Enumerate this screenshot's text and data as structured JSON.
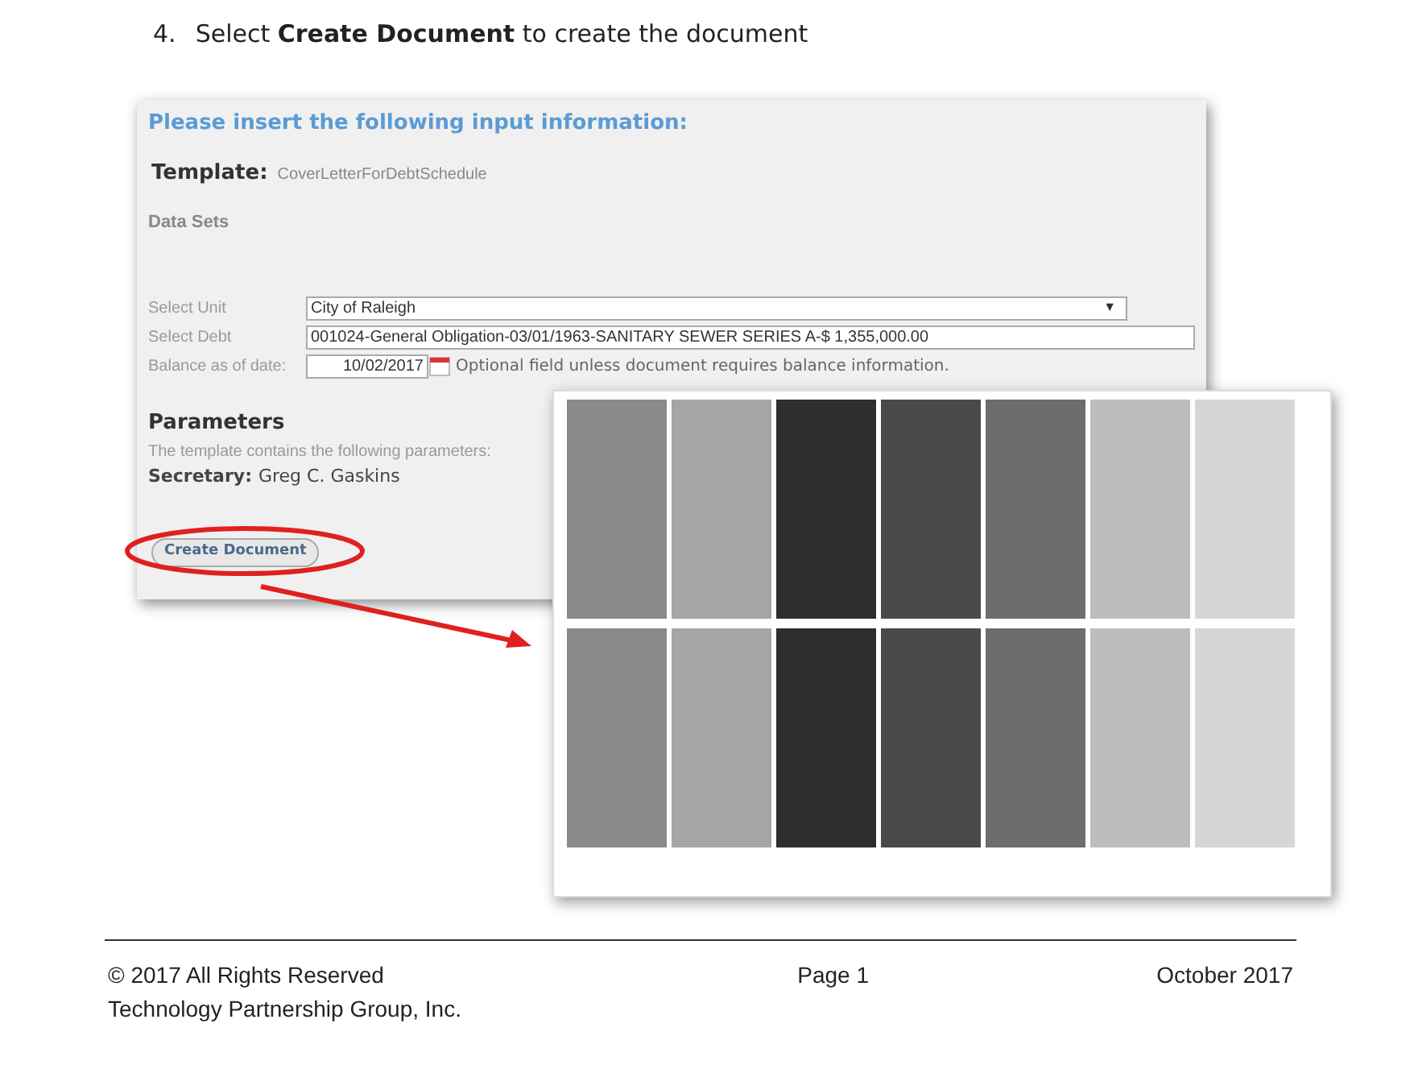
{
  "step": {
    "number": "4.",
    "text": "Select **Create Document** to create the document"
  },
  "form": {
    "heading": "Please insert the following input information:",
    "template_label": "Template:",
    "template_value": "CoverLetterForDebtSchedule",
    "data_sets": "Data Sets",
    "fields": [
      {
        "kind": "select",
        "label": "Select Unit",
        "value": "City of Raleigh",
        "caret": "▼"
      },
      {
        "kind": "text",
        "label": "Select Debt",
        "value": "001024-General Obligation-03/01/1963-SANITARY SEWER SERIES A-$ 1,355,000.00"
      },
      {
        "kind": "date",
        "label": "Balance as of date:",
        "value": "10/02/2017",
        "hint": "Optional field unless document requires balance information."
      }
    ],
    "parameters_title": "Parameters",
    "parameters_note": "The template contains the following parameters:",
    "parameters": [
      {
        "name": "Secretary:",
        "value": "Greg C. Gaskins"
      }
    ],
    "button": "Create Document",
    "button_highlighted": true
  },
  "footer": {
    "left": [
      "© 2017 All Rights Reserved",
      "Technology Partnership Group, Inc."
    ],
    "center": "Page 1",
    "right": "October 2017"
  }
}
